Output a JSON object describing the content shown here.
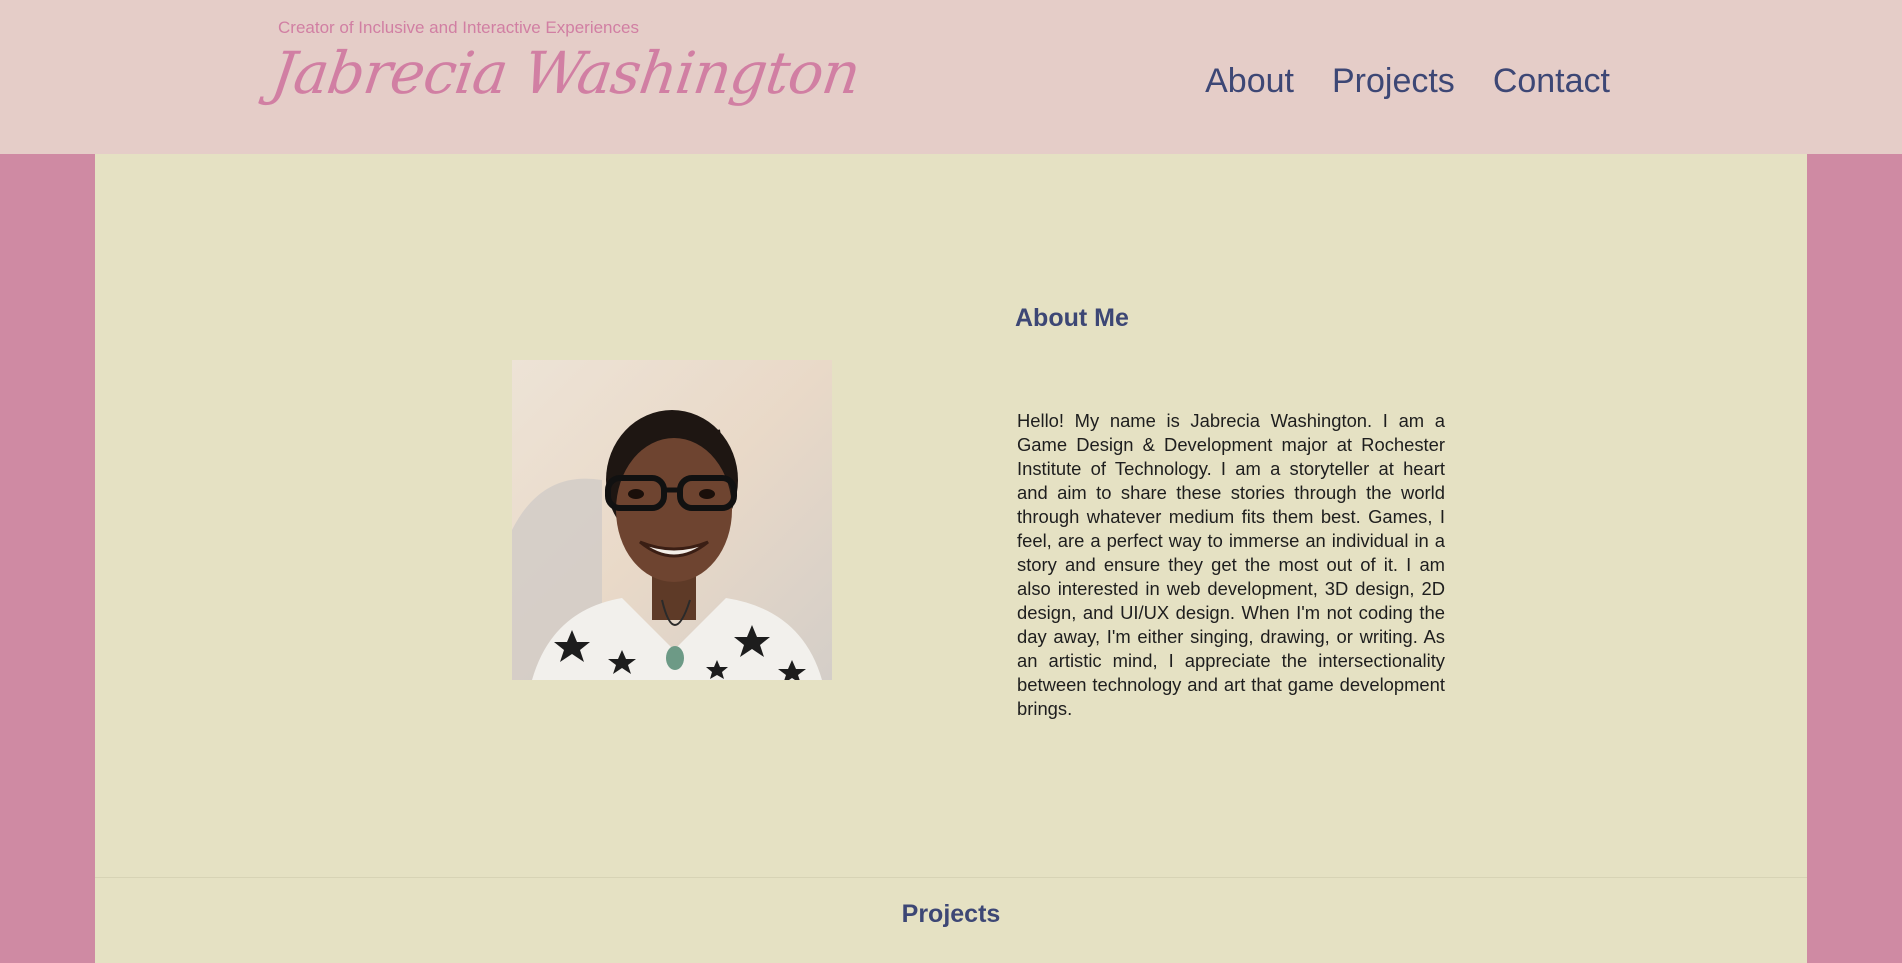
{
  "header": {
    "tagline": "Creator of Inclusive and Interactive Experiences",
    "brand": "Jabrecia Washington",
    "nav": [
      "About",
      "Projects",
      "Contact"
    ]
  },
  "about": {
    "heading": "About Me",
    "text": "Hello! My name is Jabrecia Washington. I am a Game Design & Development major at Rochester Institute of Technology. I am a storyteller at heart and aim to share these stories through the world through whatever medium fits them best. Games, I feel, are a perfect way to immerse an individual in a story and ensure they get the most out of it. I am also interested in web development, 3D design, 2D design, and UI/UX design. When I'm not coding the day away, I'm either singing, drawing, or writing. As an artistic mind, I appreciate the intersectionality between technology and art that game development brings."
  },
  "projects": {
    "heading": "Projects"
  },
  "colors": {
    "outer": "#cf8aa3",
    "header_bg": "#e5cdc8",
    "panel_bg": "#e5e1c3",
    "accent_pink": "#d17fa3",
    "accent_navy": "#3d4775"
  }
}
